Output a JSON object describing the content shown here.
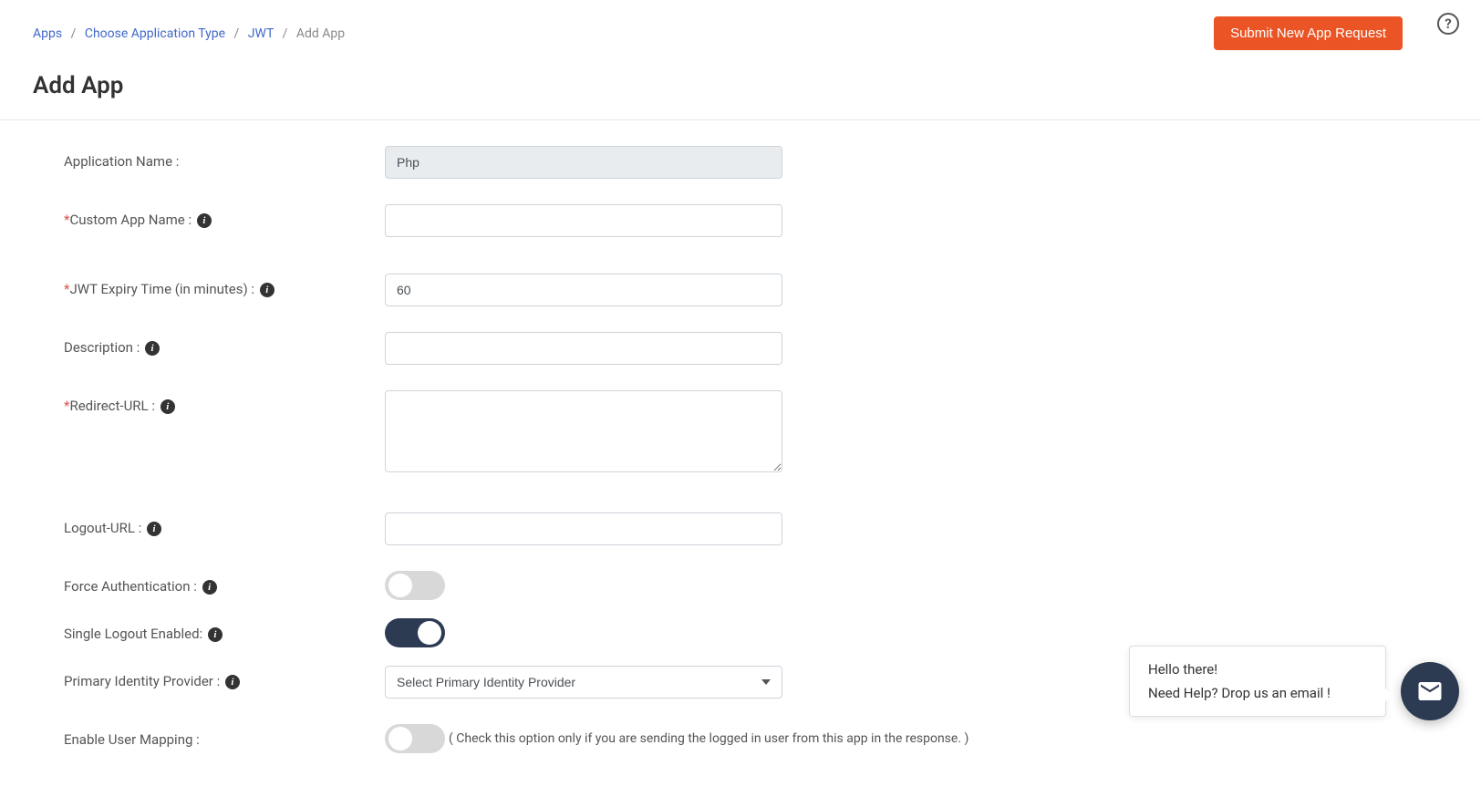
{
  "breadcrumb": {
    "items": [
      {
        "label": "Apps"
      },
      {
        "label": "Choose Application Type"
      },
      {
        "label": "JWT"
      }
    ],
    "current": "Add App"
  },
  "header": {
    "submit_button": "Submit New App Request",
    "page_title": "Add App"
  },
  "form": {
    "app_name": {
      "label": "Application Name :",
      "value": "Php"
    },
    "custom_app_name": {
      "label": "Custom App Name :",
      "value": ""
    },
    "jwt_expiry": {
      "label": "JWT Expiry Time (in minutes) :",
      "value": "60"
    },
    "description": {
      "label": "Description :",
      "value": ""
    },
    "redirect_url": {
      "label": "Redirect-URL :",
      "value": ""
    },
    "logout_url": {
      "label": "Logout-URL :",
      "value": ""
    },
    "force_auth": {
      "label": "Force Authentication :",
      "enabled": false
    },
    "single_logout": {
      "label": "Single Logout Enabled:",
      "enabled": true
    },
    "primary_idp": {
      "label": "Primary Identity Provider :",
      "placeholder": "Select Primary Identity Provider"
    },
    "user_mapping": {
      "label": "Enable User Mapping :",
      "enabled": false,
      "hint": "( Check this option only if you are sending the logged in user from this app in the response. )"
    }
  },
  "help_widget": {
    "greeting": "Hello there!",
    "message": "Need Help? Drop us an email !"
  }
}
